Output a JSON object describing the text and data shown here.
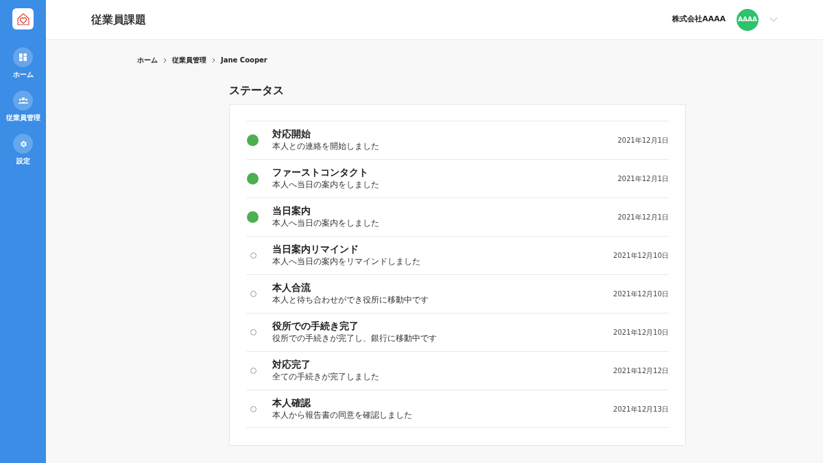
{
  "sidebar": {
    "items": [
      {
        "kind": "home",
        "label": "ホーム",
        "selected": false
      },
      {
        "kind": "people",
        "label": "従業員管理",
        "selected": false
      },
      {
        "kind": "settings",
        "label": "設定",
        "selected": false
      }
    ]
  },
  "header": {
    "title": "従業員課題",
    "company": "株式会社AAAA",
    "avatar": "AAAA"
  },
  "breadcrumb": [
    "ホーム",
    "従業員管理",
    "Jane Cooper"
  ],
  "section_title": "ステータス",
  "statuses": [
    {
      "title": "対応開始",
      "description": "本人との連絡を開始しました",
      "date": "2021年12月1日",
      "done": true
    },
    {
      "title": "ファーストコンタクト",
      "description": "本人へ当日の案内をしました",
      "date": "2021年12月1日",
      "done": true
    },
    {
      "title": "当日案内",
      "description": "本人へ当日の案内をしました",
      "date": "2021年12月1日",
      "done": true
    },
    {
      "title": "当日案内リマインド",
      "description": "本人へ当日の案内をリマインドしました",
      "date": "2021年12月10日",
      "done": false
    },
    {
      "title": "本人合流",
      "description": "本人と待ち合わせができ役所に移動中です",
      "date": "2021年12月10日",
      "done": false
    },
    {
      "title": "役所での手続き完了",
      "description": "役所での手続きが完了し、銀行に移動中です",
      "date": "2021年12月10日",
      "done": false
    },
    {
      "title": "対応完了",
      "description": "全ての手続きが完了しました",
      "date": "2021年12月12日",
      "done": false
    },
    {
      "title": "本人確認",
      "description": "本人から報告書の同意を確認しました",
      "date": "2021年12月13日",
      "done": false
    }
  ]
}
